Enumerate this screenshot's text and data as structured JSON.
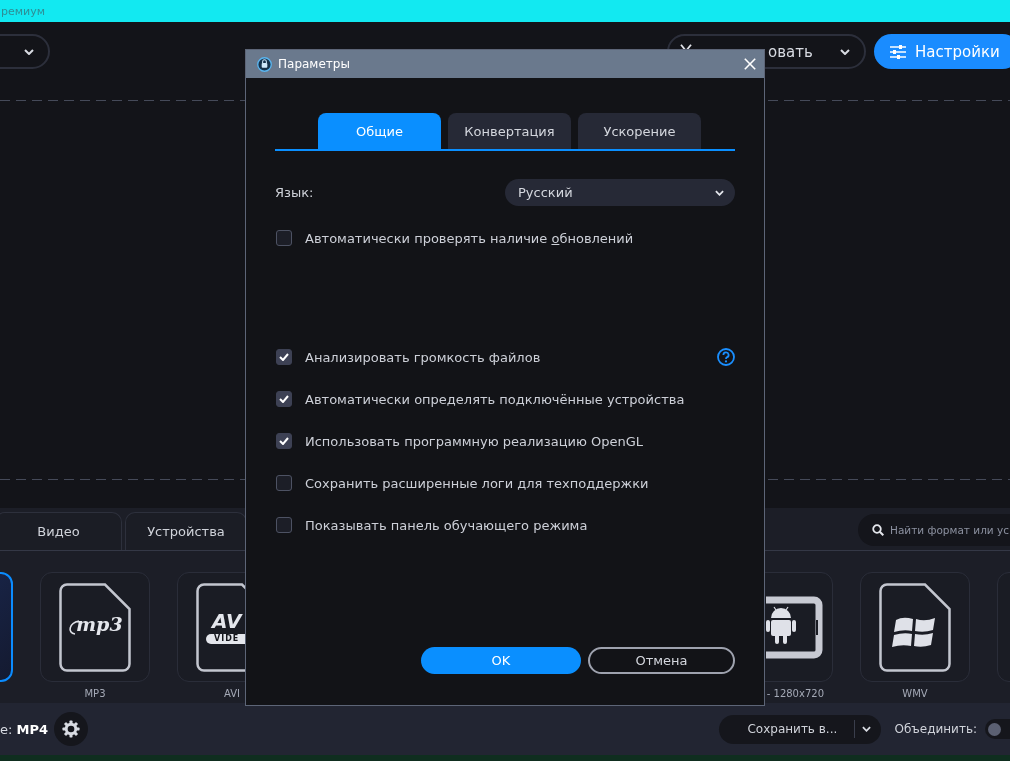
{
  "app": {
    "title": "ремиум"
  },
  "header": {
    "tool_dropdown": {
      "label": "овать"
    },
    "settings_button": {
      "label": "Настройки"
    }
  },
  "format_panel": {
    "tabs": [
      {
        "label": "Видео",
        "selected": false
      },
      {
        "label": "Устройства",
        "selected": false
      }
    ],
    "search": {
      "placeholder": "Найти формат или ус"
    },
    "tiles": [
      {
        "kind": "blank",
        "selected": true
      },
      {
        "kind": "mp3",
        "selected": false,
        "logo": "mp3",
        "label": "MP3"
      },
      {
        "kind": "avi",
        "selected": false,
        "logo": "AV",
        "logo_band": "VIDE",
        "label": "AVI"
      },
      {
        "kind": "android",
        "selected": false,
        "label": "- 1280x720"
      },
      {
        "kind": "windows",
        "selected": false,
        "label": "WMV"
      },
      {
        "kind": "blank",
        "selected": false
      }
    ]
  },
  "bottom_bar": {
    "output_format": "е: **MP4**",
    "save_button": {
      "label": "Сохранить в..."
    },
    "merge": {
      "label": "Объединить:",
      "on": false
    }
  },
  "dialog": {
    "title": "Параметры",
    "tabs": [
      {
        "label": "Общие",
        "selected": true
      },
      {
        "label": "Конвертация",
        "selected": false
      },
      {
        "label": "Ускорение",
        "selected": false
      }
    ],
    "language": {
      "label": "Язык:",
      "value": "Русский"
    },
    "auto_update": {
      "label_before": "Автоматически проверять наличие ",
      "mnemonic": "о",
      "label_after": "бновлений",
      "checked": false
    },
    "options": [
      {
        "label": "Анализировать громкость файлов",
        "checked": true,
        "help": true
      },
      {
        "label": "Автоматически определять подключённые устройства",
        "checked": true,
        "help": false
      },
      {
        "label": "Использовать программную реализацию OpenGL",
        "checked": true,
        "help": false
      },
      {
        "label": "Сохранить расширенные логи для техподдержки",
        "checked": false,
        "help": false
      },
      {
        "label": "Показывать панель обучающего режима",
        "checked": false,
        "help": false
      }
    ],
    "buttons": [
      {
        "label": "OK",
        "kind": "primary"
      },
      {
        "label": "Отмена",
        "kind": "secondary"
      }
    ]
  }
}
